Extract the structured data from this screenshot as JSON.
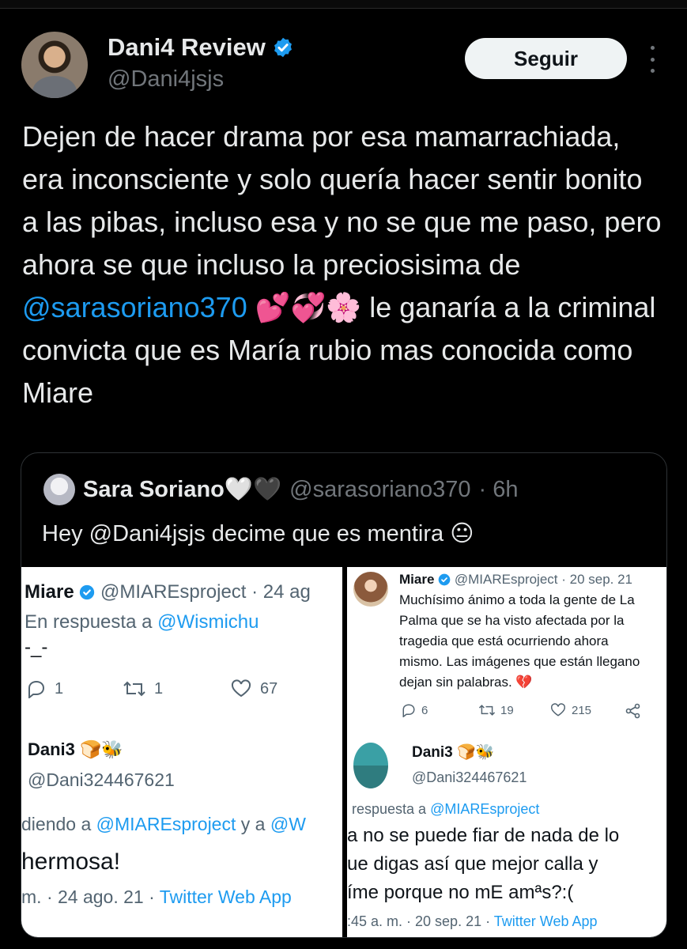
{
  "author": {
    "name": "Dani4 Review",
    "handle": "@Dani4jsjs",
    "follow_label": "Seguir",
    "verified_icon": "verified-badge-icon",
    "accent_color": "#1d9bf0"
  },
  "tweet": {
    "text_part1": "Dejen de hacer drama por esa mamarrachiada, era inconsciente y solo quería hacer sentir bonito a las pibas, incluso esa y no se que me paso, pero ahora se que incluso la preciosisima de ",
    "mention": "@sarasoriano370",
    "emojis": "💕💞🌸",
    "text_part2": " le ganaría a la criminal convicta que es María rubio mas conocida como Miare"
  },
  "quoted": {
    "name": "Sara Soriano🤍🖤",
    "handle": "@sarasoriano370",
    "time": "· 6h",
    "text": "Hey @Dani4jsjs decime que es mentira 😐"
  },
  "left_shot": {
    "tweet1_name": "Miare",
    "tweet1_handle_time": "@MIAREsproject · 24 ag",
    "reply_prefix": "En respuesta a ",
    "reply_to": "@Wismichu",
    "tweet1_text": "-_-",
    "stats": {
      "replies": "1",
      "retweets": "1",
      "likes": "67"
    },
    "tweet2_name": "Dani3 🍞🐝",
    "tweet2_handle": "@Dani324467621",
    "reply2_prefix": "diendo a ",
    "reply2_to": "@MIAREsproject",
    "reply2_mid": " y a ",
    "reply2_to2": "@W",
    "tweet2_text": "hermosa!",
    "footer_prefix": "m. · 24 ago. 21 · ",
    "footer_app": "Twitter Web App"
  },
  "right_shot": {
    "tweet1_name": "Miare",
    "tweet1_handle_time": "@MIAREsproject · 20 sep. 21",
    "tweet1_line1": "Muchísimo ánimo a toda la gente de La",
    "tweet1_line2": "Palma que se ha visto afectada por la",
    "tweet1_line3": "tragedia que está ocurriendo ahora",
    "tweet1_line4": "mismo. Las imágenes que están llegano",
    "tweet1_line5": "dejan sin palabras. 💔",
    "stats": {
      "replies": "6",
      "retweets": "19",
      "likes": "215"
    },
    "tweet2_name": "Dani3 🍞🐝",
    "tweet2_handle": "@Dani324467621",
    "reply_prefix": "respuesta a ",
    "reply_to": "@MIAREsproject",
    "text_line1": "a no se puede fiar de nada de lo",
    "text_line2": "ue digas así que mejor calla y",
    "text_line3": "íme porque no mE amªs?:(",
    "footer_prefix": ":45 a. m. · 20 sep. 21 · ",
    "footer_app": "Twitter Web App"
  }
}
